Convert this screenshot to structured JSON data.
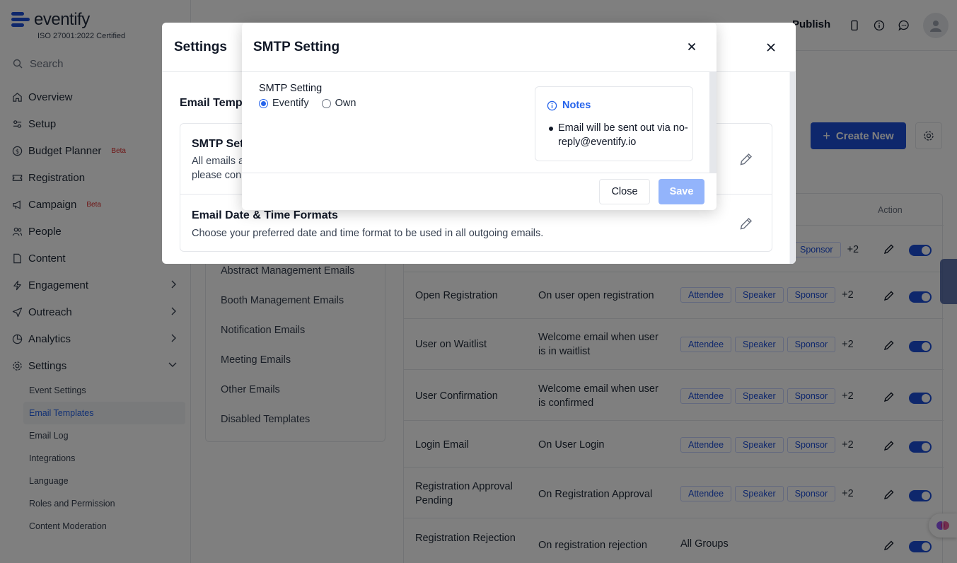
{
  "brand": {
    "name": "eventify",
    "cert": "ISO 27001:2022 Certified"
  },
  "search": {
    "placeholder": "Search"
  },
  "nav": [
    {
      "label": "Overview",
      "icon": "home-icon"
    },
    {
      "label": "Setup",
      "icon": "sliders-icon"
    },
    {
      "label": "Budget Planner",
      "icon": "dollar-icon",
      "badge": "Beta"
    },
    {
      "label": "Registration",
      "icon": "ticket-icon"
    },
    {
      "label": "Campaign",
      "icon": "megaphone-icon",
      "badge": "Beta"
    },
    {
      "label": "People",
      "icon": "people-icon"
    },
    {
      "label": "Content",
      "icon": "file-icon"
    },
    {
      "label": "Engagement",
      "icon": "bolt-icon"
    },
    {
      "label": "Outreach",
      "icon": "send-icon"
    },
    {
      "label": "Analytics",
      "icon": "chart-icon"
    },
    {
      "label": "Settings",
      "icon": "gear-icon"
    }
  ],
  "settings_sub": [
    "Event Settings",
    "Email Templates",
    "Email Log",
    "Integrations",
    "Language",
    "Roles and Permission",
    "Content Moderation"
  ],
  "topbar": {
    "publish": "Publish"
  },
  "main": {
    "create_new": "Create New",
    "action_header": "Action"
  },
  "categories": [
    "Abstract Management Emails",
    "Booth Management Emails",
    "Notification Emails",
    "Meeting Emails",
    "Other Emails",
    "Disabled Templates"
  ],
  "rows": [
    {
      "name": "Open Registration",
      "trigger": "On user open registration"
    },
    {
      "name": "User on Waitlist",
      "trigger": "Welcome email when user is in waitlist"
    },
    {
      "name": "User Confirmation",
      "trigger": "Welcome email when user is confirmed"
    },
    {
      "name": "Login Email",
      "trigger": "On User Login"
    },
    {
      "name": "Registration Approval Pending",
      "trigger": "On Registration Approval"
    },
    {
      "name": "Registration Rejection",
      "trigger": "On registration rejection",
      "groups": "All Groups"
    }
  ],
  "tags": {
    "a": "Attendee",
    "b": "Speaker",
    "c": "Sponsor",
    "more": "+2"
  },
  "settings_modal": {
    "title": "Settings",
    "section": "Email Temp",
    "card1_title": "SMTP Set",
    "card1_desc1": "All emails a",
    "card1_desc2": "please con",
    "card2_title": "Email Date & Time Formats",
    "card2_desc": "Choose your preferred date and time format to be used in all outgoing emails."
  },
  "smtp_modal": {
    "title": "SMTP Setting",
    "label": "SMTP Setting",
    "option1": "Eventify",
    "option2": "Own",
    "notes_title": "Notes",
    "notes_text": "Email will be sent out via no-reply@eventify.io",
    "close": "Close",
    "save": "Save"
  },
  "colors": {
    "primary": "#1d4ed8",
    "accent": "#2563eb",
    "save_disabled": "#93b4fb"
  }
}
